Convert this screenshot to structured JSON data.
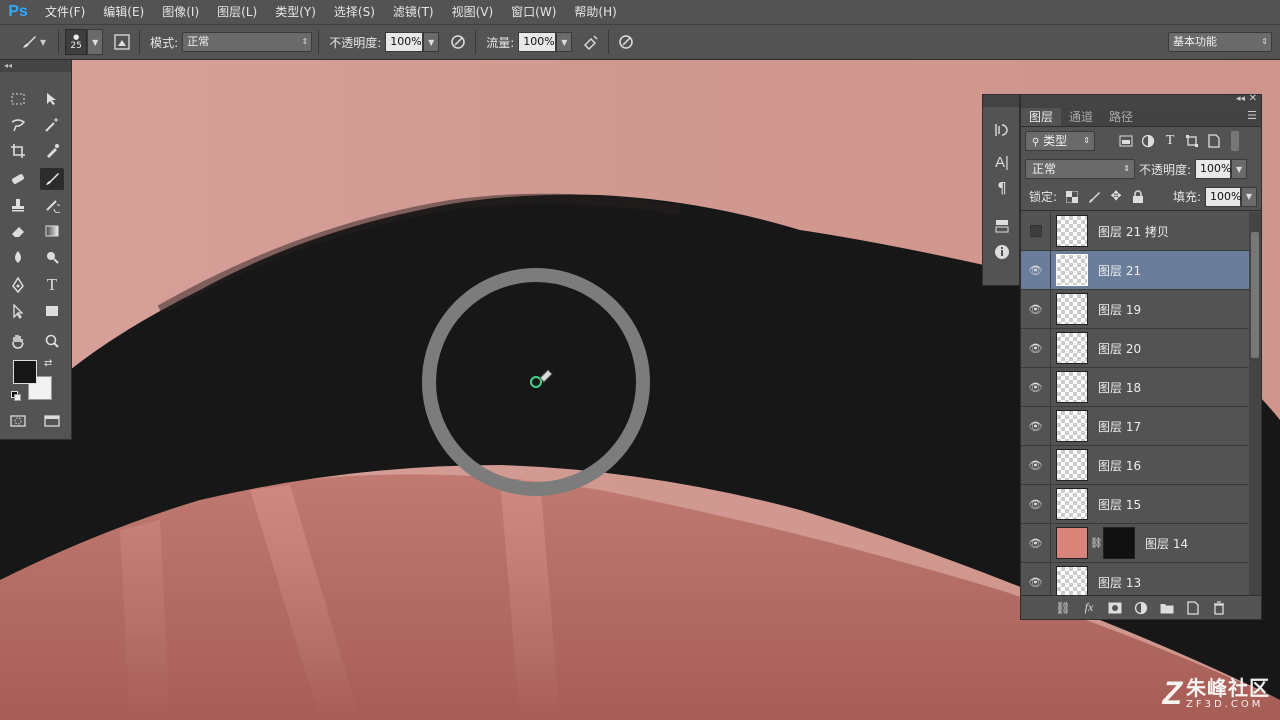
{
  "app": {
    "logo": "Ps",
    "menu": [
      "文件(F)",
      "编辑(E)",
      "图像(I)",
      "图层(L)",
      "类型(Y)",
      "选择(S)",
      "滤镜(T)",
      "视图(V)",
      "窗口(W)",
      "帮助(H)"
    ]
  },
  "options": {
    "brush_size": "25",
    "mode_label": "模式:",
    "mode_value": "正常",
    "opacity_label": "不透明度:",
    "opacity_value": "100%",
    "flow_label": "流量:",
    "flow_value": "100%",
    "workspace": "基本功能"
  },
  "layers_panel": {
    "tabs": [
      "图层",
      "通道",
      "路径"
    ],
    "filter_label": "类型",
    "blend_mode": "正常",
    "opacity_label": "不透明度:",
    "opacity_value": "100%",
    "lock_label": "锁定:",
    "fill_label": "填充:",
    "fill_value": "100%",
    "layers": [
      {
        "name": "图层 21 拷贝",
        "visible": false,
        "selected": false,
        "thumb": "transparent"
      },
      {
        "name": "图层 21",
        "visible": true,
        "selected": true,
        "thumb": "transparent"
      },
      {
        "name": "图层 19",
        "visible": true,
        "selected": false,
        "thumb": "transparent"
      },
      {
        "name": "图层 20",
        "visible": true,
        "selected": false,
        "thumb": "transparent"
      },
      {
        "name": "图层 18",
        "visible": true,
        "selected": false,
        "thumb": "transparent"
      },
      {
        "name": "图层 17",
        "visible": true,
        "selected": false,
        "thumb": "transparent"
      },
      {
        "name": "图层 16",
        "visible": true,
        "selected": false,
        "thumb": "transparent"
      },
      {
        "name": "图层 15",
        "visible": true,
        "selected": false,
        "thumb": "transparent"
      },
      {
        "name": "图层 14",
        "visible": true,
        "selected": false,
        "thumb": "face",
        "mask": true
      },
      {
        "name": "图层 13",
        "visible": true,
        "selected": false,
        "thumb": "transparent"
      }
    ]
  },
  "colors": {
    "skin": "#c4867f",
    "brow": "#171717",
    "selection": "#6a7e9c",
    "brand": "#31a8ff"
  },
  "watermark": {
    "logo": "Z",
    "name_cn": "朱峰社区",
    "name_en": "ZF3D.COM"
  }
}
